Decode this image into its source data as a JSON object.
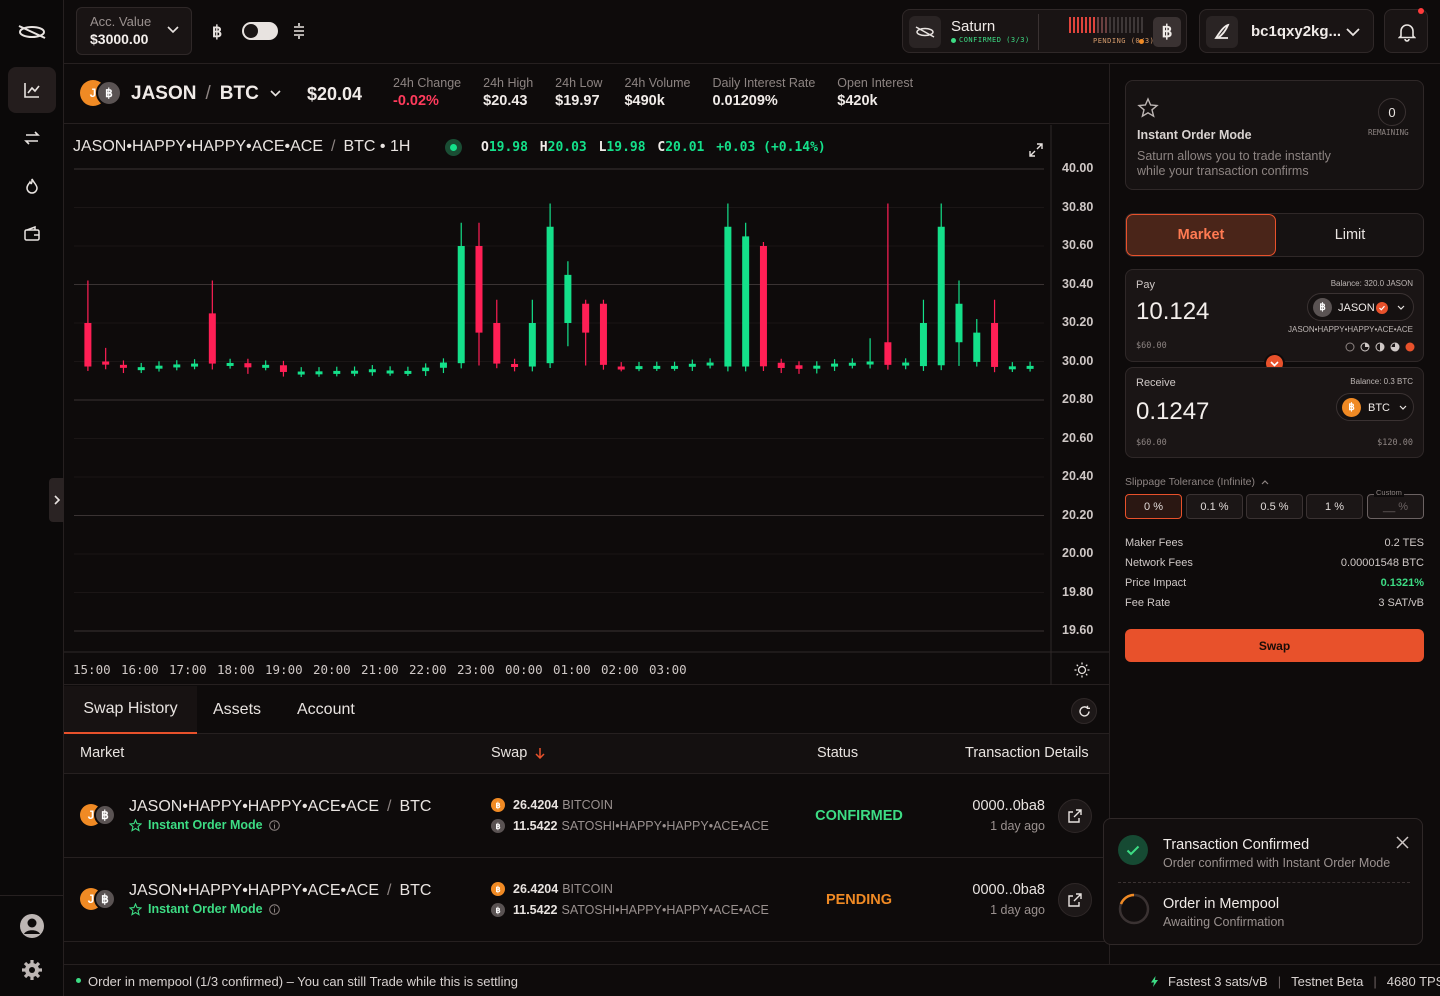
{
  "account": {
    "label": "Acc. Value",
    "value": "$3000.00"
  },
  "satellite": {
    "name": "Saturn",
    "confirmed": "CONFIRMED (3/3)",
    "pending": "PENDING (0/3)"
  },
  "wallet": {
    "address": "bc1qxy2kg..."
  },
  "market": {
    "base": "JASON",
    "sep": "/",
    "quote": "BTC",
    "price": "$20.04",
    "stats": [
      {
        "label": "24h Change",
        "value": "-0.02%",
        "color": "#ff3b5c"
      },
      {
        "label": "24h High",
        "value": "$20.43",
        "color": "#f0ebe8"
      },
      {
        "label": "24h Low",
        "value": "$19.97",
        "color": "#f0ebe8"
      },
      {
        "label": "24h Volume",
        "value": "$490k",
        "color": "#f0ebe8"
      },
      {
        "label": "Daily Interest Rate",
        "value": "0.01209%",
        "color": "#f0ebe8"
      },
      {
        "label": "Open Interest",
        "value": "$420k",
        "color": "#f0ebe8"
      }
    ]
  },
  "chart_header": {
    "pair": "JASON•HAPPY•HAPPY•ACE•ACE",
    "sep": "/",
    "quote_tf": "BTC • 1H",
    "o_label": "O",
    "o": "19.98",
    "h_label": "H",
    "h": "20.03",
    "l_label": "L",
    "l": "19.98",
    "c_label": "C",
    "c": "20.01",
    "change": "+0.03 (+0.14%)"
  },
  "chart_data": {
    "type": "candlestick",
    "y_ticks": [
      "40.00",
      "30.80",
      "30.60",
      "30.40",
      "30.20",
      "30.00",
      "20.80",
      "20.60",
      "20.40",
      "20.20",
      "20.00",
      "19.80",
      "19.60"
    ],
    "x_ticks": [
      "15:00",
      "16:00",
      "17:00",
      "18:00",
      "19:00",
      "20:00",
      "21:00",
      "22:00",
      "23:00",
      "00:00",
      "01:00",
      "02:00",
      "03:00"
    ],
    "colors": {
      "up": "#14e08a",
      "down": "#ff1f55"
    },
    "candles": [
      [
        30.2,
        30.4,
        29.8,
        28.8,
        28.7
      ],
      [
        30.0,
        30.05,
        29.2,
        29.25,
        29.1
      ],
      [
        29.2,
        29.3,
        28.3,
        28.5,
        28.2
      ],
      [
        28.4,
        28.7,
        28.3,
        28.65,
        28.2
      ],
      [
        28.7,
        29.1,
        28.7,
        29.0,
        28.55
      ],
      [
        29.0,
        29.35,
        28.9,
        29.3,
        28.85
      ],
      [
        29.2,
        29.6,
        29.15,
        29.5,
        29.1
      ],
      [
        30.25,
        30.4,
        29.1,
        29.5,
        29.05
      ],
      [
        29.4,
        29.7,
        29.3,
        29.65,
        29.25
      ],
      [
        29.6,
        29.7,
        28.3,
        28.6,
        28.0
      ],
      [
        29.1,
        29.3,
        29.0,
        29.2,
        28.85
      ],
      [
        29.1,
        29.2,
        27.4,
        27.5,
        27.35
      ],
      [
        27.4,
        27.7,
        27.3,
        27.6,
        27.25
      ],
      [
        27.5,
        27.7,
        27.4,
        27.65,
        27.3
      ],
      [
        27.55,
        27.8,
        27.5,
        27.75,
        27.4
      ],
      [
        27.6,
        27.85,
        27.55,
        27.8,
        27.45
      ],
      [
        27.7,
        28.2,
        27.6,
        28.15,
        27.55
      ],
      [
        27.7,
        27.9,
        27.65,
        27.85,
        27.55
      ],
      [
        27.6,
        27.8,
        27.55,
        27.75,
        27.5
      ],
      [
        27.7,
        28.6,
        27.6,
        28.55,
        27.5
      ],
      [
        28.5,
        29.8,
        28.4,
        29.75,
        28.2
      ],
      [
        29.6,
        30.7,
        29.5,
        30.6,
        29.3
      ],
      [
        30.6,
        30.7,
        30.1,
        30.15,
        30.0
      ],
      [
        30.2,
        30.3,
        29.4,
        29.5,
        29.35
      ],
      [
        29.4,
        29.7,
        28.7,
        28.8,
        28.6
      ],
      [
        28.8,
        30.3,
        28.7,
        30.2,
        28.6
      ],
      [
        29.6,
        30.8,
        29.5,
        30.7,
        29.4
      ],
      [
        30.2,
        30.5,
        30.2,
        30.45,
        30.1
      ],
      [
        30.3,
        30.3,
        30.1,
        30.15,
        30.0
      ],
      [
        30.3,
        30.3,
        29.1,
        29.2,
        29.0
      ],
      [
        28.8,
        28.9,
        28.65,
        28.7,
        28.6
      ],
      [
        28.8,
        28.95,
        28.75,
        28.9,
        28.65
      ],
      [
        28.8,
        29.0,
        28.8,
        28.95,
        28.7
      ],
      [
        28.85,
        29.0,
        28.85,
        28.95,
        28.75
      ],
      [
        29.0,
        29.5,
        28.85,
        29.45,
        28.7
      ],
      [
        29.5,
        29.8,
        29.4,
        29.75,
        29.3
      ],
      [
        28.8,
        30.8,
        28.7,
        30.7,
        28.6
      ],
      [
        28.8,
        30.7,
        28.7,
        30.65,
        28.6
      ],
      [
        30.6,
        30.6,
        28.8,
        28.85,
        28.7
      ],
      [
        29.7,
        29.7,
        28.4,
        28.45,
        28.2
      ],
      [
        29.1,
        29.1,
        28.2,
        28.25,
        28.0
      ],
      [
        28.3,
        29.1,
        28.2,
        29.0,
        28.1
      ],
      [
        28.9,
        29.6,
        28.8,
        29.5,
        28.7
      ],
      [
        29.5,
        29.8,
        29.4,
        29.7,
        29.3
      ],
      [
        29.5,
        30.1,
        29.4,
        30.0,
        29.3
      ],
      [
        30.1,
        30.8,
        29.1,
        29.2,
        29.0
      ],
      [
        29.3,
        29.8,
        29.2,
        29.75,
        29.1
      ],
      [
        28.9,
        30.3,
        28.8,
        30.2,
        28.7
      ],
      [
        29.1,
        30.8,
        29.0,
        30.7,
        28.9
      ],
      [
        30.1,
        30.4,
        30.0,
        30.3,
        29.9
      ],
      [
        29.9,
        30.2,
        29.85,
        30.15,
        29.75
      ],
      [
        30.2,
        30.3,
        28.6,
        28.7,
        28.4
      ],
      [
        28.6,
        28.9,
        28.55,
        28.85,
        28.45
      ],
      [
        28.7,
        29.0,
        28.6,
        28.95,
        28.55
      ]
    ]
  },
  "tabs": [
    "Swap History",
    "Assets",
    "Account"
  ],
  "table": {
    "headers": {
      "market": "Market",
      "swap": "Swap",
      "status": "Status",
      "details": "Transaction Details"
    },
    "rows": [
      {
        "pair": "JASON•HAPPY•HAPPY•ACE•ACE",
        "sep": "/",
        "quote": "BTC",
        "mode": "Instant Order Mode",
        "amt1": "26.4204",
        "asset1": "BITCOIN",
        "amt2": "11.5422",
        "asset2": "SATOSHI•HAPPY•HAPPY•ACE•ACE",
        "status": "CONFIRMED",
        "status_color": "#3ddc84",
        "tx": "0000..0ba8",
        "time": "1 day ago"
      },
      {
        "pair": "JASON•HAPPY•HAPPY•ACE•ACE",
        "sep": "/",
        "quote": "BTC",
        "mode": "Instant Order Mode",
        "amt1": "26.4204",
        "asset1": "BITCOIN",
        "amt2": "11.5422",
        "asset2": "SATOSHI•HAPPY•HAPPY•ACE•ACE",
        "status": "PENDING",
        "status_color": "#f08a24",
        "tx": "0000..0ba8",
        "time": "1 day ago"
      }
    ]
  },
  "instant": {
    "title": "Instant Order Mode",
    "desc1": "Saturn allows you to trade instantly",
    "desc2": "while your transaction confirms",
    "count": "0",
    "remaining": "REMAINING"
  },
  "order": {
    "market": "Market",
    "limit": "Limit",
    "pay_label": "Pay",
    "pay_balance": "Balance: 320.0 JASON",
    "pay_amount": "10.124",
    "pay_usd": "$60.00",
    "pay_token": "JASON",
    "pay_sub": "JASON•HAPPY•HAPPY•ACE•ACE",
    "recv_label": "Receive",
    "recv_balance": "Balance: 0.3 BTC",
    "recv_amount": "0.1247",
    "recv_usd": "$60.00",
    "recv_usd2": "$120.00",
    "recv_token": "BTC"
  },
  "slippage": {
    "label": "Slippage Tolerance (Infinite)",
    "options": [
      "0 %",
      "0.1 %",
      "0.5 %",
      "1 %"
    ],
    "custom_label": "Custom",
    "custom_placeholder": "__ %"
  },
  "fees": [
    {
      "label": "Maker Fees",
      "value": "0.2 TES",
      "color": "#cfc8c6"
    },
    {
      "label": "Network Fees",
      "value": "0.00001548 BTC",
      "color": "#cfc8c6"
    },
    {
      "label": "Price Impact",
      "value": "0.1321%",
      "color": "#3ddc84"
    },
    {
      "label": "Fee Rate",
      "value": "3 SAT/vB",
      "color": "#cfc8c6"
    }
  ],
  "swap_button": "Swap",
  "toast": {
    "title1": "Transaction Confirmed",
    "sub1": "Order confirmed with Instant Order Mode",
    "title2": "Order in Mempool",
    "sub2": "Awaiting Confirmation"
  },
  "footer": {
    "message": "Order in mempool (1/3 confirmed) – You can still Trade while this is settling",
    "fastest": "Fastest 3 sats/vB",
    "network": "Testnet Beta",
    "tps": "4680 TPS"
  }
}
